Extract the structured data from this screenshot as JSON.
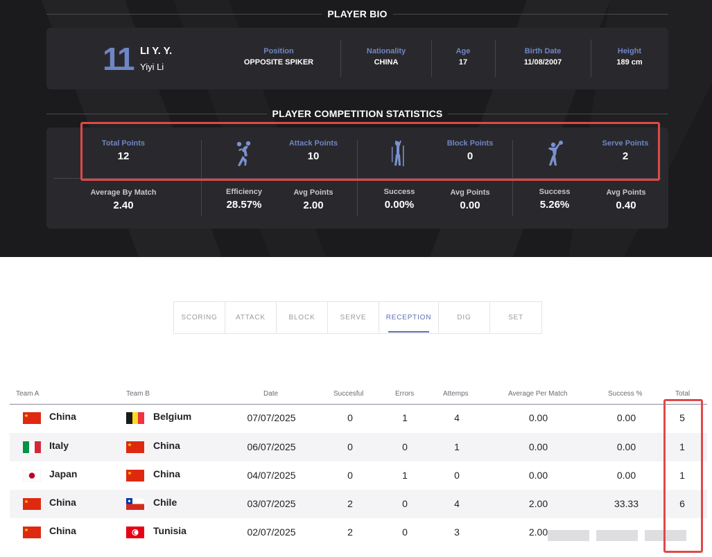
{
  "bio": {
    "section_title": "PLAYER BIO",
    "jersey": "11",
    "short_name": "LI Y. Y.",
    "full_name": "Yiyi Li",
    "fields": [
      {
        "label": "Position",
        "value": "OPPOSITE SPIKER"
      },
      {
        "label": "Nationality",
        "value": "CHINA"
      },
      {
        "label": "Age",
        "value": "17"
      },
      {
        "label": "Birth Date",
        "value": "11/08/2007"
      },
      {
        "label": "Height",
        "value": "189 cm"
      }
    ]
  },
  "stats": {
    "section_title": "PLAYER COMPETITION STATISTICS",
    "total": {
      "label": "Total Points",
      "value": "12",
      "sub_label": "Average By Match",
      "sub_value": "2.40"
    },
    "attack": {
      "icon": "spike-player-icon",
      "label": "Attack Points",
      "value": "10",
      "sub1_label": "Efficiency",
      "sub1_value": "28.57%",
      "sub2_label": "Avg Points",
      "sub2_value": "2.00"
    },
    "block": {
      "icon": "block-player-icon",
      "label": "Block Points",
      "value": "0",
      "sub1_label": "Success",
      "sub1_value": "0.00%",
      "sub2_label": "Avg Points",
      "sub2_value": "0.00"
    },
    "serve": {
      "icon": "serve-player-icon",
      "label": "Serve Points",
      "value": "2",
      "sub1_label": "Success",
      "sub1_value": "5.26%",
      "sub2_label": "Avg Points",
      "sub2_value": "0.40"
    }
  },
  "tabs": [
    "SCORING",
    "ATTACK",
    "BLOCK",
    "SERVE",
    "RECEPTION",
    "DIG",
    "SET"
  ],
  "active_tab": "RECEPTION",
  "table": {
    "headers": [
      "Team A",
      "Team B",
      "Date",
      "Succesful",
      "Errors",
      "Attemps",
      "Average Per Match",
      "Success %",
      "Total"
    ],
    "rows": [
      {
        "team_a": "China",
        "team_b": "Belgium",
        "date": "07/07/2025",
        "successful": "0",
        "errors": "1",
        "attempts": "4",
        "avg": "0.00",
        "success_pct": "0.00",
        "total": "5"
      },
      {
        "team_a": "Italy",
        "team_b": "China",
        "date": "06/07/2025",
        "successful": "0",
        "errors": "0",
        "attempts": "1",
        "avg": "0.00",
        "success_pct": "0.00",
        "total": "1"
      },
      {
        "team_a": "Japan",
        "team_b": "China",
        "date": "04/07/2025",
        "successful": "0",
        "errors": "1",
        "attempts": "0",
        "avg": "0.00",
        "success_pct": "0.00",
        "total": "1"
      },
      {
        "team_a": "China",
        "team_b": "Chile",
        "date": "03/07/2025",
        "successful": "2",
        "errors": "0",
        "attempts": "4",
        "avg": "2.00",
        "success_pct": "33.33",
        "total": "6"
      },
      {
        "team_a": "China",
        "team_b": "Tunisia",
        "date": "02/07/2025",
        "successful": "2",
        "errors": "0",
        "attempts": "3",
        "avg": "2.00",
        "success_pct": "",
        "total": ""
      }
    ]
  },
  "colors": {
    "accent": "#6f86c6",
    "dark_bg": "#1b1b1d",
    "card_bg": "#29292d",
    "highlight": "#e04848",
    "tab_active": "#5d6fb0"
  }
}
